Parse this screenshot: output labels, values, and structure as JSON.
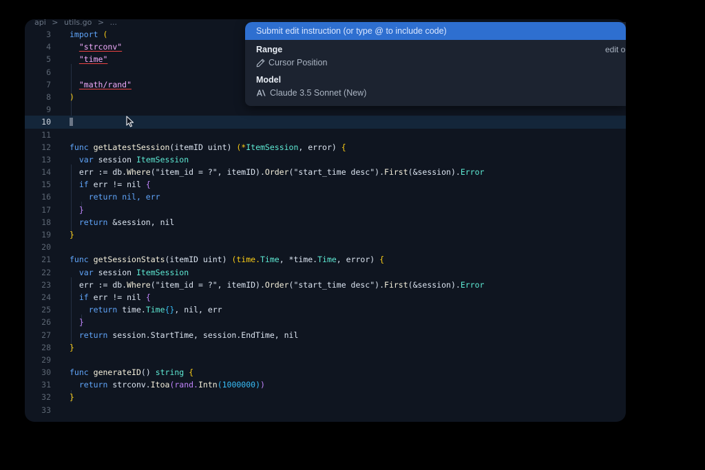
{
  "breadcrumb": {
    "folder": "api",
    "separator": ">",
    "file": "utils.go",
    "more": "..."
  },
  "editor": {
    "current_line": 10,
    "line_numbers": [
      "3",
      "4",
      "5",
      "6",
      "7",
      "8",
      "9",
      "10",
      "11",
      "12",
      "13",
      "14",
      "15",
      "16",
      "17",
      "18",
      "19",
      "20",
      "21",
      "22",
      "23",
      "24",
      "25",
      "26",
      "27",
      "28",
      "29",
      "30",
      "31",
      "32",
      "33"
    ]
  },
  "code": {
    "import_kw": "import",
    "import_open": "(",
    "imp_strconv": "\"strconv\"",
    "imp_time": "\"time\"",
    "imp_rand": "\"math/rand\"",
    "import_close": ")",
    "l12_func": "func",
    "l12_name": "getLatestSession",
    "l12_params": "(itemID uint)",
    "l12_ret_open": "(*",
    "l12_ret_type": "ItemSession",
    "l12_ret_rest": ", error)",
    "l12_brace": "{",
    "var_kw": "var",
    "var_name": "session",
    "var_type": "ItemSession",
    "err_assign": "err := db.",
    "where_fn": "Where",
    "where_args": "(\"item_id = ?\", itemID).",
    "order_fn": "Order",
    "order_args": "(\"start_time desc\").",
    "first_fn": "First",
    "first_args": "(&session).",
    "error_field": "Error",
    "if_kw": "if",
    "if_cond": "err != nil",
    "brace_open": "{",
    "return_kw": "return",
    "l16_ret": "nil, err",
    "brace_close": "}",
    "l18_ret": "&session, nil",
    "func_close": "}",
    "l21_func": "func",
    "l21_name": "getSessionStats",
    "l21_params": "(itemID uint)",
    "l21_ret_open": "(time.",
    "l21_ret_type1": "Time",
    "l21_ret_mid": ", *time.",
    "l21_ret_type2": "Time",
    "l21_ret_rest": ", error)",
    "l21_brace": "{",
    "l25_ret_pre": "time.",
    "l25_ret_type": "Time",
    "l25_ret_braces": "{}",
    "l25_ret_rest": ", nil, err",
    "l27_ret": "session.StartTime, session.EndTime, nil",
    "l30_func": "func",
    "l30_name": "generateID",
    "l30_params": "()",
    "l30_ret": "string",
    "l30_brace": "{",
    "l31_pre": "strconv.",
    "l31_itoa": "Itoa",
    "l31_open": "(rand.",
    "l31_intn": "Intn",
    "l31_arg": "(1000000)",
    "l31_close": ")"
  },
  "overlay": {
    "instruction_placeholder": "Submit edit instruction (or type @ to include code)",
    "range_label": "Range",
    "range_value": "Cursor Position",
    "model_label": "Model",
    "model_value": "Claude 3.5 Sonnet (New)",
    "edit_options": "edit op"
  },
  "icons": {
    "pencil": "pencil-icon",
    "anthropic": "anthropic-logo-icon",
    "cursor": "mouse-pointer-icon"
  }
}
